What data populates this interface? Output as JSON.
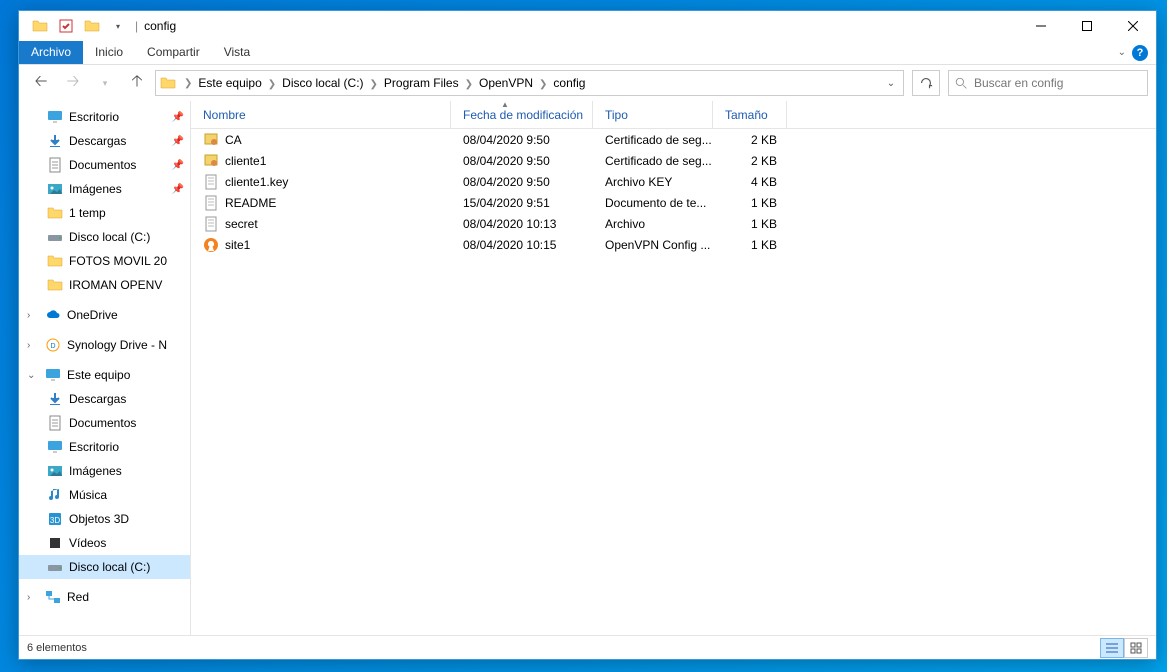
{
  "window": {
    "title": "config"
  },
  "ribbon": {
    "file": "Archivo",
    "tabs": [
      "Inicio",
      "Compartir",
      "Vista"
    ]
  },
  "breadcrumbs": [
    "Este equipo",
    "Disco local (C:)",
    "Program Files",
    "OpenVPN",
    "config"
  ],
  "search": {
    "placeholder": "Buscar en config"
  },
  "columns": {
    "name": "Nombre",
    "date": "Fecha de modificación",
    "type": "Tipo",
    "size": "Tamaño"
  },
  "files": [
    {
      "icon": "cert",
      "name": "CA",
      "date": "08/04/2020 9:50",
      "type": "Certificado de seg...",
      "size": "2 KB"
    },
    {
      "icon": "cert",
      "name": "cliente1",
      "date": "08/04/2020 9:50",
      "type": "Certificado de seg...",
      "size": "2 KB"
    },
    {
      "icon": "text",
      "name": "cliente1.key",
      "date": "08/04/2020 9:50",
      "type": "Archivo KEY",
      "size": "4 KB"
    },
    {
      "icon": "text",
      "name": "README",
      "date": "15/04/2020 9:51",
      "type": "Documento de te...",
      "size": "1 KB"
    },
    {
      "icon": "text",
      "name": "secret",
      "date": "08/04/2020 10:13",
      "type": "Archivo",
      "size": "1 KB"
    },
    {
      "icon": "ovpn",
      "name": "site1",
      "date": "08/04/2020 10:15",
      "type": "OpenVPN Config ...",
      "size": "1 KB"
    }
  ],
  "sidebar": {
    "quick": [
      {
        "icon": "monitor",
        "label": "Escritorio",
        "pin": true
      },
      {
        "icon": "down",
        "label": "Descargas",
        "pin": true
      },
      {
        "icon": "doc",
        "label": "Documentos",
        "pin": true
      },
      {
        "icon": "pic",
        "label": "Imágenes",
        "pin": true
      },
      {
        "icon": "folder",
        "label": "1 temp"
      },
      {
        "icon": "disk",
        "label": "Disco local (C:)"
      },
      {
        "icon": "folder",
        "label": "FOTOS MOVIL 20"
      },
      {
        "icon": "folder",
        "label": "IROMAN OPENV"
      }
    ],
    "onedrive": "OneDrive",
    "synology": "Synology Drive - N",
    "thispc": {
      "label": "Este equipo",
      "items": [
        {
          "icon": "down",
          "label": "Descargas"
        },
        {
          "icon": "doc",
          "label": "Documentos"
        },
        {
          "icon": "monitor",
          "label": "Escritorio"
        },
        {
          "icon": "pic",
          "label": "Imágenes"
        },
        {
          "icon": "music",
          "label": "Música"
        },
        {
          "icon": "3d",
          "label": "Objetos 3D"
        },
        {
          "icon": "video",
          "label": "Vídeos"
        },
        {
          "icon": "disk",
          "label": "Disco local (C:)",
          "selected": true
        }
      ]
    },
    "network": "Red"
  },
  "status": "6 elementos"
}
